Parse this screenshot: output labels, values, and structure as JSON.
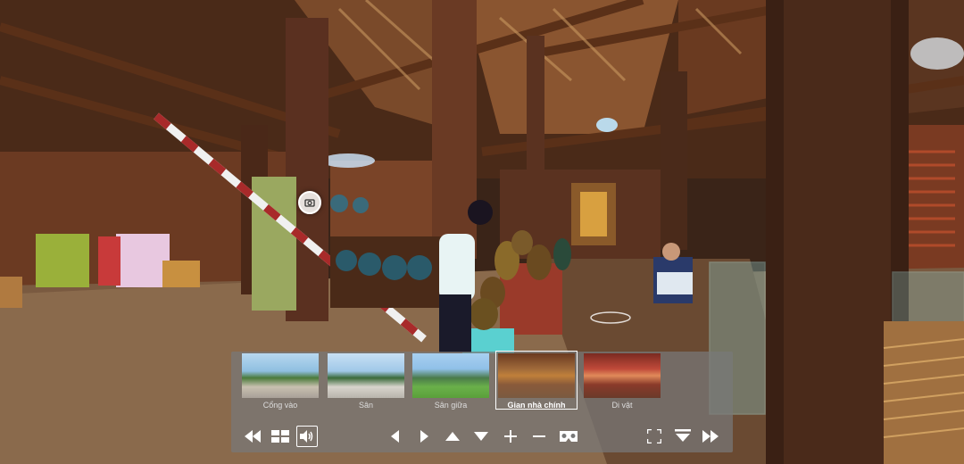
{
  "viewer": {
    "title": "Gian nhà chính",
    "colors": {
      "wood_dark": "#3b2216",
      "wood_mid": "#6b3a22",
      "panel_bg": "#7a7a7a",
      "accent": "#ffffff"
    }
  },
  "scenes": [
    {
      "label": "Cổng vào",
      "active": false
    },
    {
      "label": "Sân",
      "active": false
    },
    {
      "label": "Sân giữa",
      "active": false
    },
    {
      "label": "Gian nhà chính",
      "active": true
    },
    {
      "label": "Di vật",
      "active": false
    }
  ],
  "controls": {
    "icons": [
      "rewind-icon",
      "grid-icon",
      "sound-icon",
      "pan-left-icon",
      "pan-right-icon",
      "pan-up-icon",
      "pan-down-icon",
      "zoom-in-icon",
      "zoom-out-icon",
      "vr-icon",
      "fullscreen-icon",
      "hide-icon",
      "forward-icon"
    ]
  }
}
